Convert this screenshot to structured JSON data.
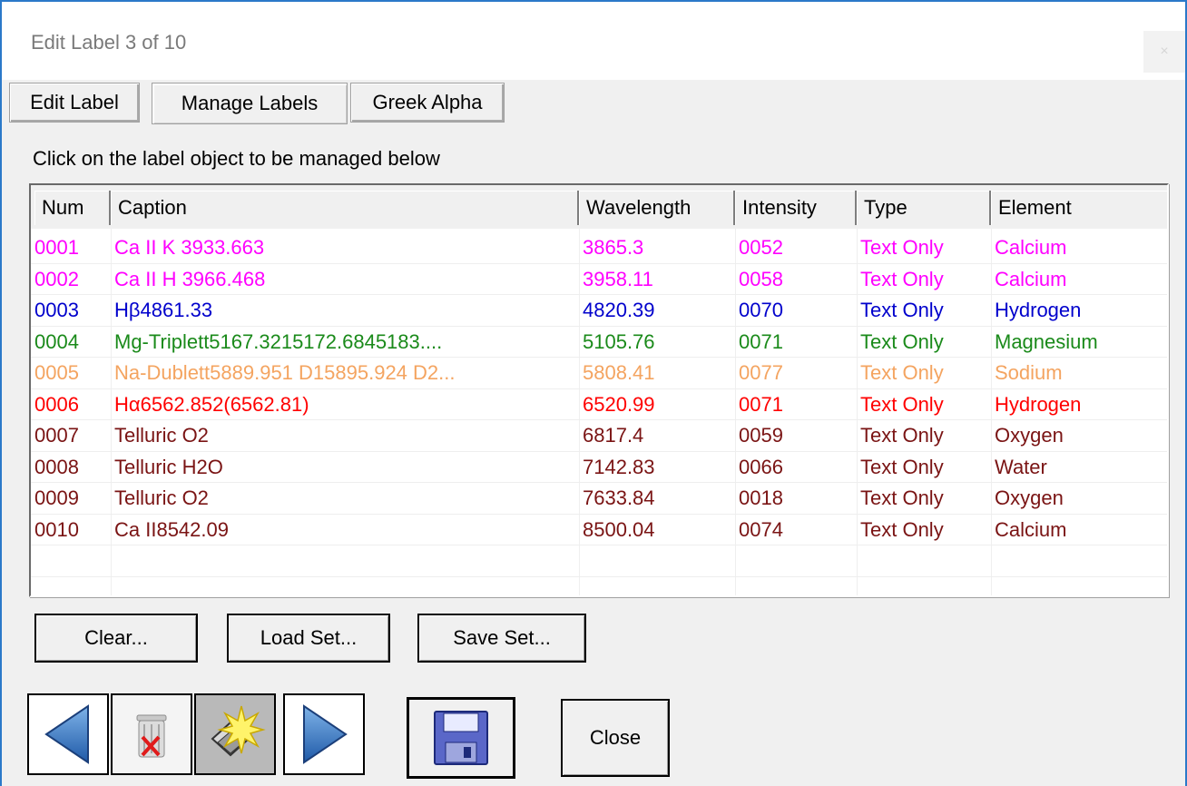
{
  "window": {
    "title": "Edit Label 3 of 10",
    "close_glyph": "×"
  },
  "tabs": [
    {
      "label": "Edit Label"
    },
    {
      "label": "Manage Labels",
      "active": true
    },
    {
      "label": "Greek Alpha"
    }
  ],
  "instruction": "Click on the label object to be managed below",
  "table": {
    "columns": [
      "Num",
      "Caption",
      "Wavelength",
      "Intensity",
      "Type",
      "Element"
    ],
    "rows": [
      {
        "num": "0001",
        "caption": "Ca II K 3933.663",
        "wavelength": "3865.3",
        "intensity": "0052",
        "type": "Text Only",
        "element": "Calcium",
        "color": "#ff00ff"
      },
      {
        "num": "0002",
        "caption": "Ca II H 3966.468",
        "wavelength": "3958.11",
        "intensity": "0058",
        "type": "Text Only",
        "element": "Calcium",
        "color": "#ff00ff"
      },
      {
        "num": "0003",
        "caption": "Hβ4861.33",
        "wavelength": "4820.39",
        "intensity": "0070",
        "type": "Text Only",
        "element": "Hydrogen",
        "color": "#0000cc"
      },
      {
        "num": "0004",
        "caption": "Mg-Triplett5167.3215172.6845183....",
        "wavelength": "5105.76",
        "intensity": "0071",
        "type": "Text Only",
        "element": "Magnesium",
        "color": "#1a8a1a"
      },
      {
        "num": "0005",
        "caption": "Na-Dublett5889.951 D15895.924 D2...",
        "wavelength": "5808.41",
        "intensity": "0077",
        "type": "Text Only",
        "element": "Sodium",
        "color": "#f4a460"
      },
      {
        "num": "0006",
        "caption": "Hα6562.852(6562.81)",
        "wavelength": "6520.99",
        "intensity": "0071",
        "type": "Text Only",
        "element": "Hydrogen",
        "color": "#ff0000"
      },
      {
        "num": "0007",
        "caption": "Telluric O2",
        "wavelength": "6817.4",
        "intensity": "0059",
        "type": "Text Only",
        "element": "Oxygen",
        "color": "#7a1414"
      },
      {
        "num": "0008",
        "caption": "Telluric H2O",
        "wavelength": "7142.83",
        "intensity": "0066",
        "type": "Text Only",
        "element": "Water",
        "color": "#7a1414"
      },
      {
        "num": "0009",
        "caption": "Telluric O2",
        "wavelength": "7633.84",
        "intensity": "0018",
        "type": "Text Only",
        "element": "Oxygen",
        "color": "#7a1414"
      },
      {
        "num": "0010",
        "caption": "Ca II8542.09",
        "wavelength": "8500.04",
        "intensity": "0074",
        "type": "Text Only",
        "element": "Calcium",
        "color": "#7a1414"
      }
    ]
  },
  "buttons": {
    "clear": "Clear...",
    "load_set": "Load Set...",
    "save_set": "Save Set...",
    "close": "Close"
  },
  "icons": {
    "prev": "arrow-left-icon",
    "delete": "trash-icon",
    "new_label": "star-burst-icon",
    "next": "arrow-right-icon",
    "save": "floppy-disk-icon"
  }
}
